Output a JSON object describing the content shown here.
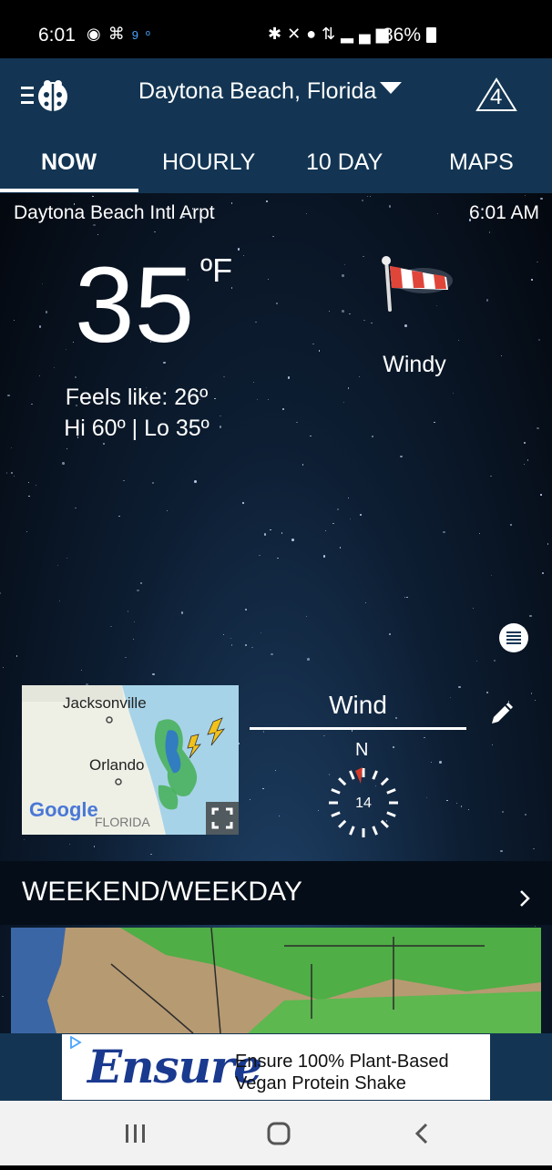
{
  "status_bar": {
    "time": "6:01",
    "temp_badge": "9º",
    "battery": "86%"
  },
  "app_bar": {
    "location": "Daytona Beach, Florida",
    "alert_count": "4"
  },
  "tabs": [
    {
      "label": "NOW",
      "active": true
    },
    {
      "label": "HOURLY",
      "active": false
    },
    {
      "label": "10 DAY",
      "active": false
    },
    {
      "label": "MAPS",
      "active": false
    }
  ],
  "current": {
    "station": "Daytona Beach Intl Arpt",
    "time": "6:01 AM",
    "temperature": "35",
    "unit": "ºF",
    "condition": "Windy",
    "condition_icon": "windsock-icon",
    "feels_like": "Feels like: 26º",
    "hi_lo": "Hi 60º | Lo 35º"
  },
  "map_thumb": {
    "cities": [
      "Jacksonville",
      "Orlando"
    ],
    "region": "FLORIDA",
    "provider": "Google"
  },
  "wind": {
    "title": "Wind",
    "direction": "N",
    "speed": "14"
  },
  "weekend": {
    "label": "WEEKEND/WEEKDAY"
  },
  "ad": {
    "brand": "Ensure",
    "text": "Ensure 100% Plant-Based Vegan Protein Shake"
  },
  "colors": {
    "app_bar": "#133553",
    "accent_red": "#d23a2a"
  }
}
